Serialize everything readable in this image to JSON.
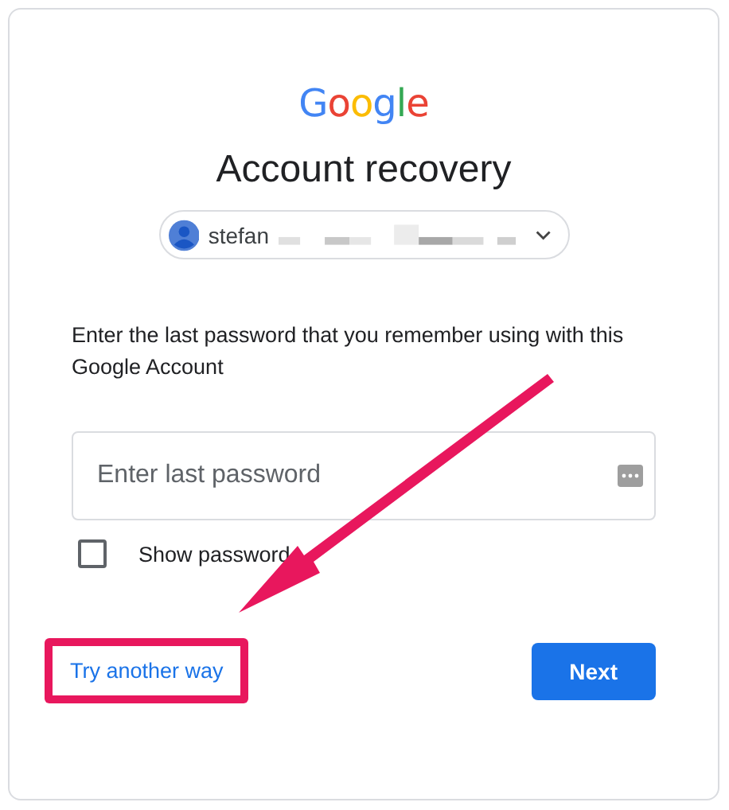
{
  "logo": {
    "letters": [
      {
        "text": "G",
        "color": "#4285f4"
      },
      {
        "text": "o",
        "color": "#ea4335"
      },
      {
        "text": "o",
        "color": "#fbbc05"
      },
      {
        "text": "g",
        "color": "#4285f4"
      },
      {
        "text": "l",
        "color": "#34a853"
      },
      {
        "text": "e",
        "color": "#ea4335"
      }
    ]
  },
  "title": "Account recovery",
  "account": {
    "name": "stefan"
  },
  "instruction": "Enter the last password that you remember using with this Google Account",
  "password_field": {
    "placeholder": "Enter last password"
  },
  "show_password": {
    "label": "Show password",
    "checked": false
  },
  "try_another_way": {
    "label": "Try another way",
    "highlighted": true
  },
  "next_button": {
    "label": "Next"
  }
}
